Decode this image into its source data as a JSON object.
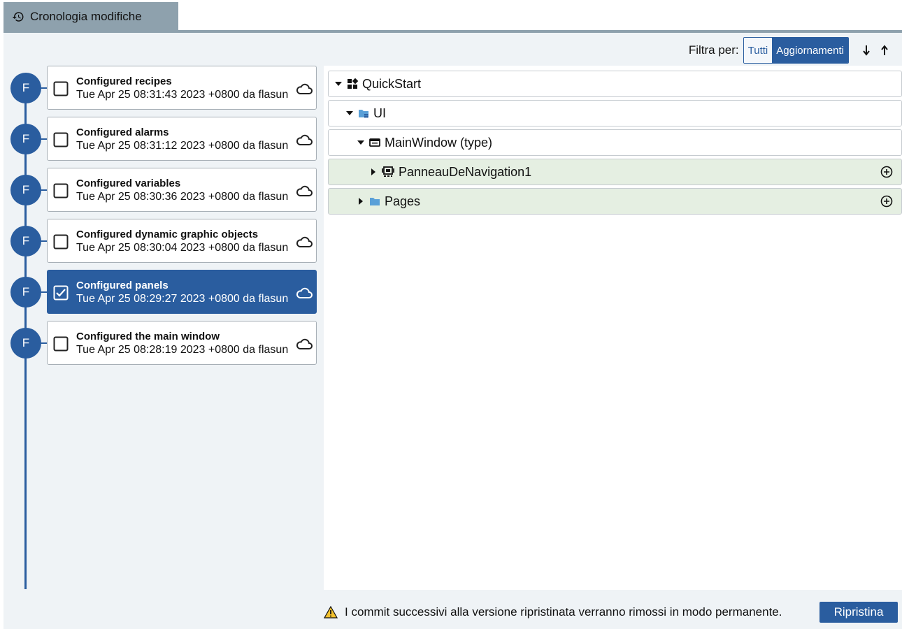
{
  "tab": {
    "title": "Cronologia modifiche",
    "icon": "history-icon"
  },
  "filter": {
    "label": "Filtra per:",
    "options": [
      "Tutti",
      "Aggiornamenti"
    ],
    "selected": "Aggiornamenti",
    "sort_desc_icon": "arrow-down-icon",
    "sort_asc_icon": "arrow-up-icon"
  },
  "commits": [
    {
      "avatar": "F",
      "title": "Configured recipes",
      "meta": "Tue Apr 25 08:31:43 2023 +0800 da flasun",
      "checked": false
    },
    {
      "avatar": "F",
      "title": "Configured alarms",
      "meta": "Tue Apr 25 08:31:12 2023 +0800 da flasun",
      "checked": false
    },
    {
      "avatar": "F",
      "title": "Configured variables",
      "meta": "Tue Apr 25 08:30:36 2023 +0800 da flasun",
      "checked": false
    },
    {
      "avatar": "F",
      "title": "Configured dynamic graphic objects",
      "meta": "Tue Apr 25 08:30:04 2023 +0800 da flasun",
      "checked": false
    },
    {
      "avatar": "F",
      "title": "Configured panels",
      "meta": "Tue Apr 25 08:29:27 2023 +0800 da flasun",
      "checked": true
    },
    {
      "avatar": "F",
      "title": "Configured the main window",
      "meta": "Tue Apr 25 08:28:19 2023 +0800 da flasun",
      "checked": false
    }
  ],
  "tree": [
    {
      "label": "QuickStart",
      "expanded": true,
      "icon": "project-icon",
      "added": false
    },
    {
      "label": "UI",
      "expanded": true,
      "icon": "ui-folder-icon",
      "added": false
    },
    {
      "label": "MainWindow (type)",
      "expanded": true,
      "icon": "window-icon",
      "added": false
    },
    {
      "label": "PanneauDeNavigation1",
      "expanded": false,
      "icon": "navigation-panel-icon",
      "added": true
    },
    {
      "label": "Pages",
      "expanded": false,
      "icon": "folder-icon",
      "added": true
    }
  ],
  "footer": {
    "warning": "I commit successivi alla versione ripristinata verranno rimossi in modo permanente.",
    "restore_label": "Ripristina"
  },
  "colors": {
    "accent": "#2a5d9f",
    "tab": "#8ea1ad",
    "added_row": "#e5efe2",
    "warning": "#f2c12e"
  }
}
